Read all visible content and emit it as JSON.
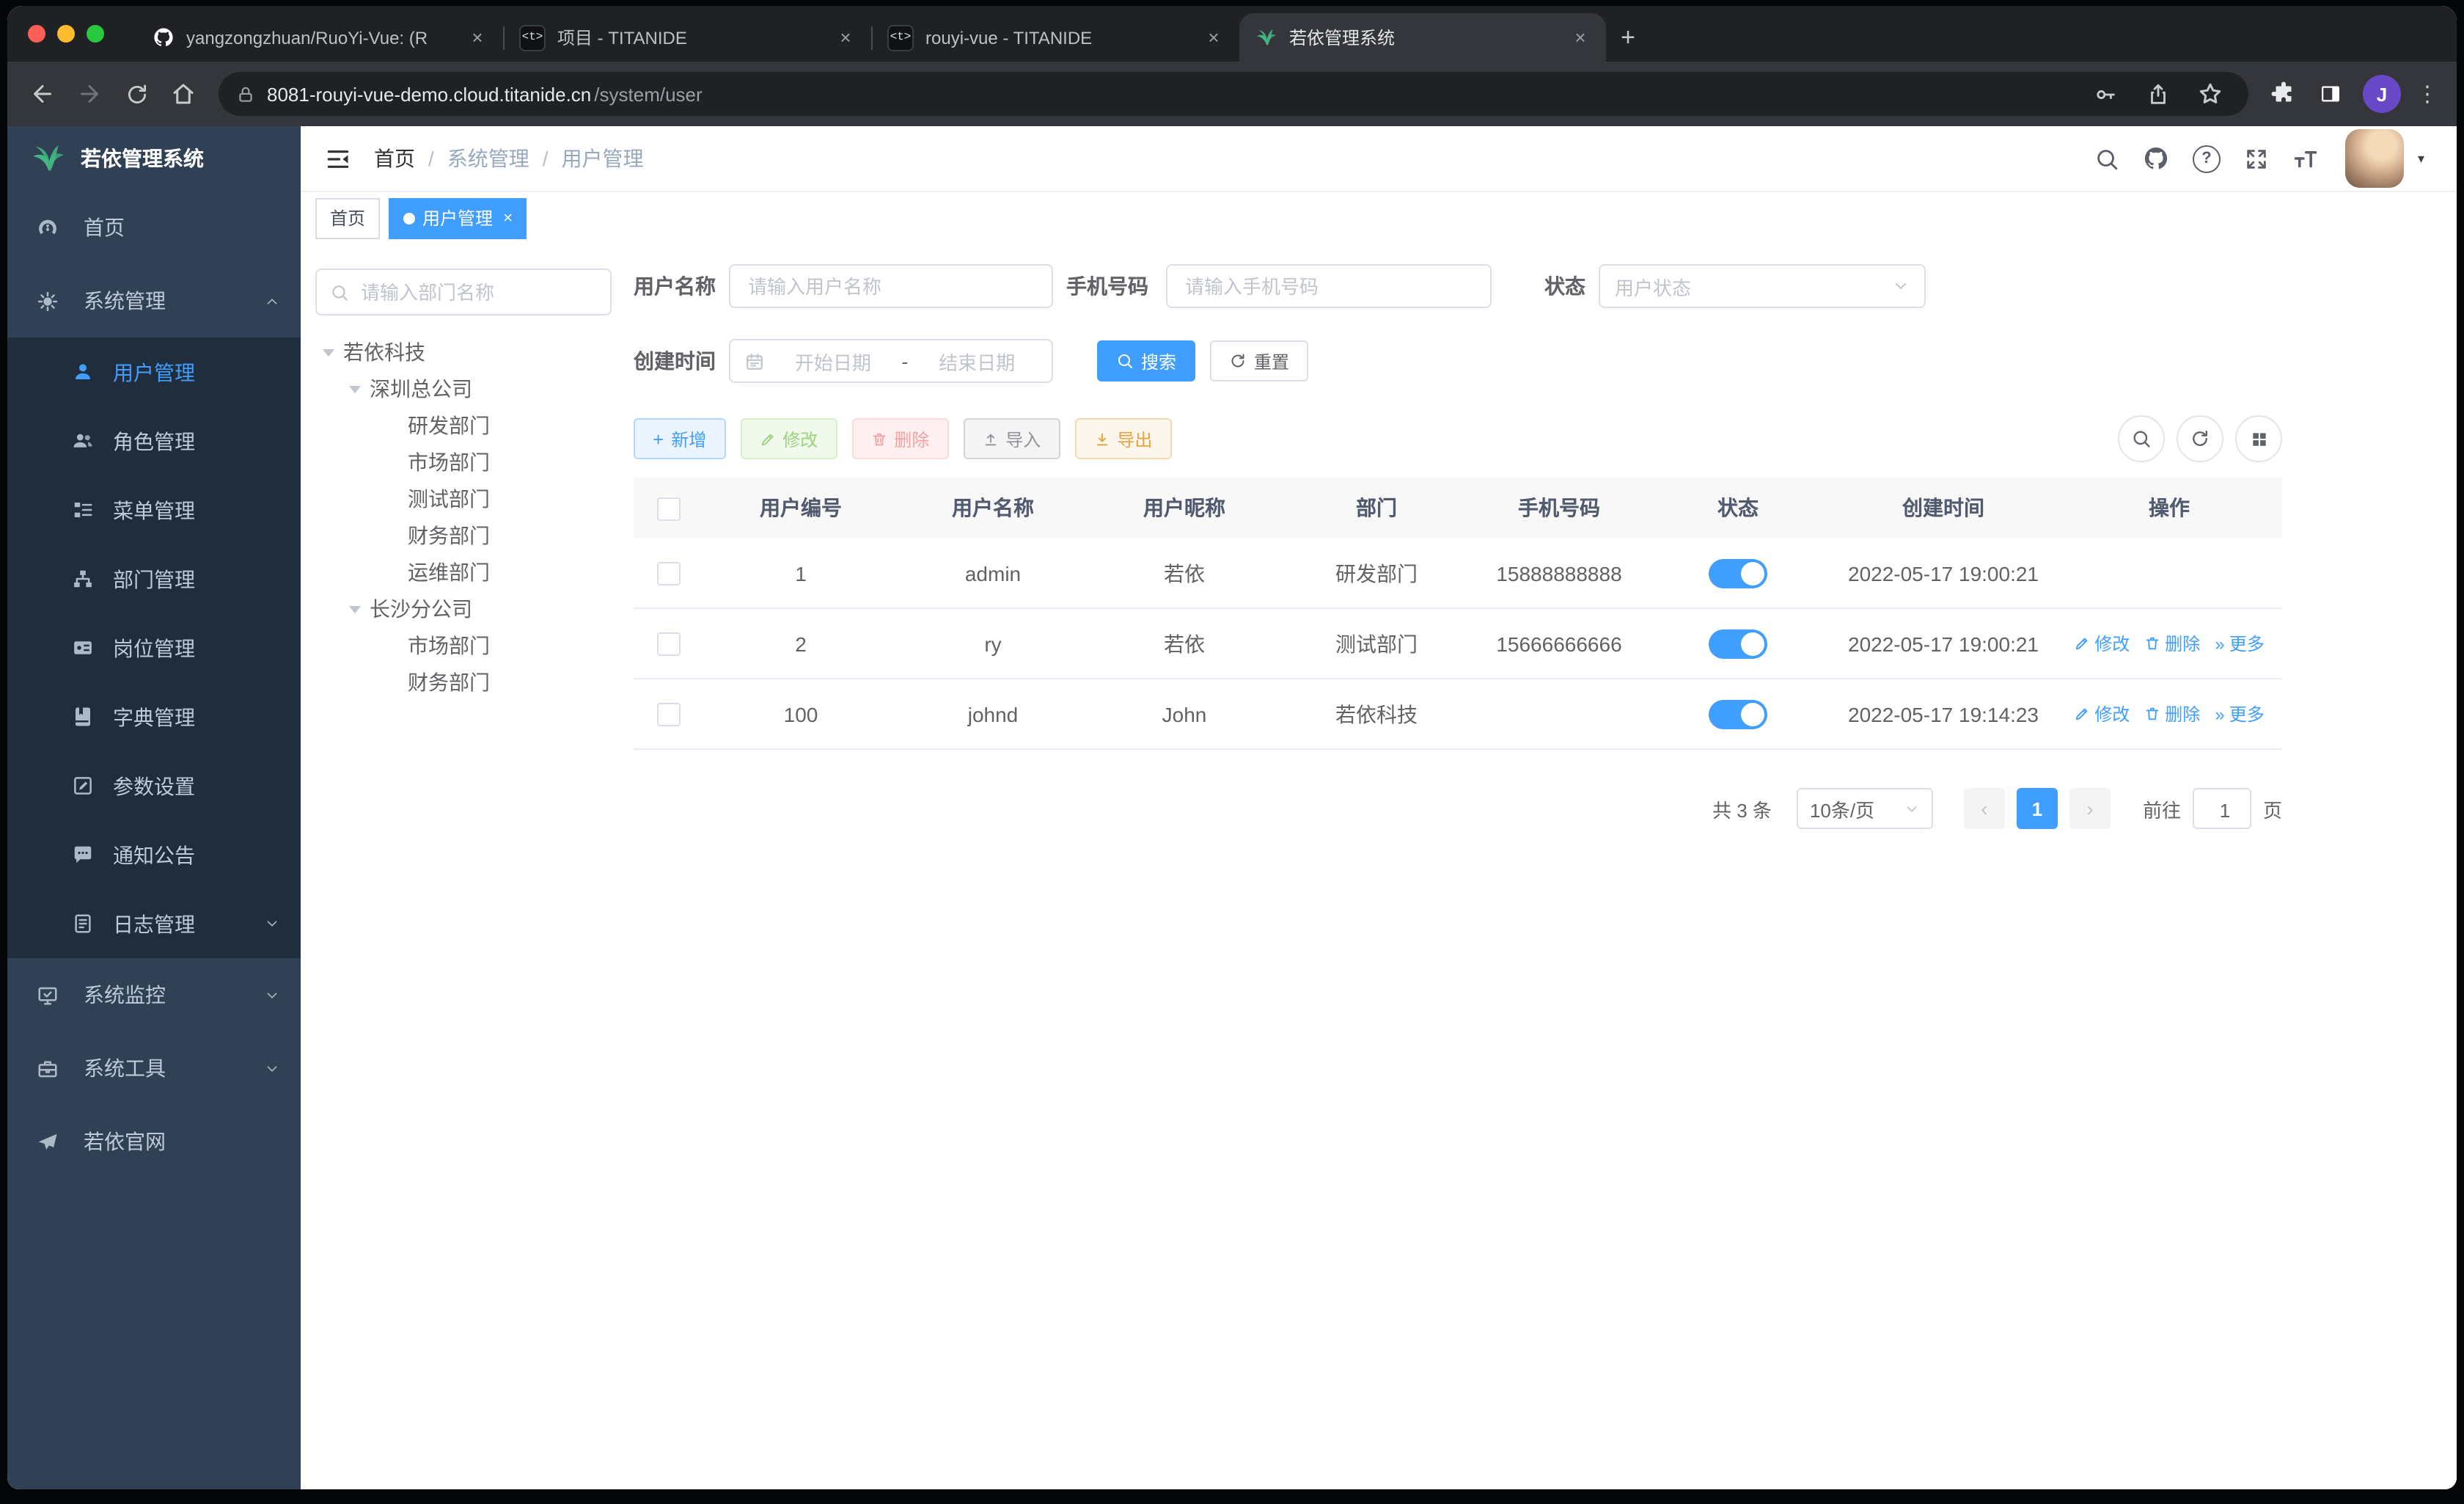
{
  "glyphs": {
    "close": "×",
    "plus": "+",
    "dots": "⋮",
    "prev": "‹",
    "next": "›",
    "more": "»",
    "question": "?",
    "caret": "▾"
  },
  "colors": {
    "accent": "#409eff",
    "sidebar_bg": "#304156",
    "submenu_bg": "#1f2d3d",
    "success": "#67c23a",
    "danger": "#f56c6c",
    "warning": "#e6a23c",
    "info": "#909399",
    "switch_on": "#409eff"
  },
  "browser": {
    "tabs": [
      {
        "title": "yangzongzhuan/RuoYi-Vue: (R"
      },
      {
        "title": "项目 - TITANIDE",
        "favicon_label": "<t>"
      },
      {
        "title": "rouyi-vue - TITANIDE",
        "favicon_label": "<t>"
      },
      {
        "title": "若依管理系统"
      }
    ],
    "url_host": "8081-rouyi-vue-demo.cloud.titanide.cn",
    "url_path": "/system/user",
    "profile_initial": "J"
  },
  "sidebar": {
    "title": "若依管理系统",
    "home": "首页",
    "system": "系统管理",
    "submenu": [
      "用户管理",
      "角色管理",
      "菜单管理",
      "部门管理",
      "岗位管理",
      "字典管理",
      "参数设置",
      "通知公告",
      "日志管理"
    ],
    "monitor": "系统监控",
    "tools": "系统工具",
    "site": "若依官网"
  },
  "navbar": {
    "breadcrumb": [
      "首页",
      "系统管理",
      "用户管理"
    ],
    "separator": "/"
  },
  "tags": {
    "home": "首页",
    "current": "用户管理"
  },
  "dept": {
    "search_placeholder": "请输入部门名称",
    "tree": [
      "若依科技",
      "深圳总公司",
      "研发部门",
      "市场部门",
      "测试部门",
      "财务部门",
      "运维部门",
      "长沙分公司",
      "市场部门",
      "财务部门"
    ]
  },
  "filters": {
    "username_label": "用户名称",
    "username_placeholder": "请输入用户名称",
    "phone_label": "手机号码",
    "phone_placeholder": "请输入手机号码",
    "status_label": "状态",
    "status_placeholder": "用户状态",
    "created_label": "创建时间",
    "date_start": "开始日期",
    "date_separator": "-",
    "date_end": "结束日期",
    "search": "搜索",
    "reset": "重置"
  },
  "actions": {
    "add": "新增",
    "edit": "修改",
    "delete": "删除",
    "import": "导入",
    "export": "导出"
  },
  "table": {
    "columns": [
      "用户编号",
      "用户名称",
      "用户昵称",
      "部门",
      "手机号码",
      "状态",
      "创建时间",
      "操作"
    ],
    "rows": [
      {
        "id": "1",
        "username": "admin",
        "nickname": "若依",
        "dept": "研发部门",
        "phone": "15888888888",
        "status": "on",
        "created": "2022-05-17 19:00:21",
        "has_actions": false
      },
      {
        "id": "2",
        "username": "ry",
        "nickname": "若依",
        "dept": "测试部门",
        "phone": "15666666666",
        "status": "on",
        "created": "2022-05-17 19:00:21",
        "has_actions": true
      },
      {
        "id": "100",
        "username": "johnd",
        "nickname": "John",
        "dept": "若依科技",
        "phone": "",
        "status": "on",
        "created": "2022-05-17 19:14:23",
        "has_actions": true
      }
    ],
    "row_actions": {
      "edit": "修改",
      "delete": "删除",
      "more": "更多"
    }
  },
  "pagination": {
    "total": "共 3 条",
    "page_size": "10条/页",
    "page": "1",
    "goto_label": "前往",
    "goto_value": "1",
    "goto_unit": "页"
  }
}
